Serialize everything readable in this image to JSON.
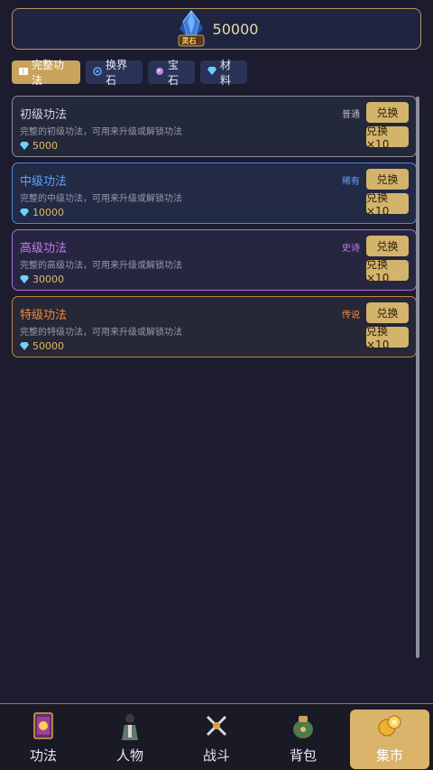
{
  "header": {
    "stone_label": "灵石",
    "amount": "50000"
  },
  "tabs": [
    {
      "label": "完整功法",
      "icon": "book-icon",
      "active": true
    },
    {
      "label": "换界石",
      "icon": "swirl-icon",
      "active": false
    },
    {
      "label": "宝石",
      "icon": "orb-icon",
      "active": false
    },
    {
      "label": "材料",
      "icon": "gem-icon",
      "active": false
    }
  ],
  "items": [
    {
      "title": "初级功法",
      "desc": "完整的初级功法，可用来升级或解锁功法",
      "price": "5000",
      "rarity": "普通",
      "btn1": "兑换",
      "btn10": "兑换×10"
    },
    {
      "title": "中级功法",
      "desc": "完整的中级功法，可用来升级或解锁功法",
      "price": "10000",
      "rarity": "稀有",
      "btn1": "兑换",
      "btn10": "兑换×10"
    },
    {
      "title": "高级功法",
      "desc": "完整的高级功法，可用来升级或解锁功法",
      "price": "30000",
      "rarity": "史诗",
      "btn1": "兑换",
      "btn10": "兑换×10"
    },
    {
      "title": "特级功法",
      "desc": "完整的特级功法，可用来升级或解锁功法",
      "price": "50000",
      "rarity": "传说",
      "btn1": "兑换",
      "btn10": "兑换×10"
    }
  ],
  "nav": [
    {
      "label": "功法",
      "icon": "scroll-book-icon",
      "active": false
    },
    {
      "label": "人物",
      "icon": "character-icon",
      "active": false
    },
    {
      "label": "战斗",
      "icon": "crossed-swords-icon",
      "active": false
    },
    {
      "label": "背包",
      "icon": "bag-icon",
      "active": false
    },
    {
      "label": "集市",
      "icon": "coins-icon",
      "active": true
    }
  ],
  "colors": {
    "accent": "#d4b36b",
    "background": "#1c1c2e",
    "common": "#d4d4dc",
    "rare": "#5ea2ff",
    "epic": "#c27cf0",
    "legend": "#f08a3c"
  }
}
